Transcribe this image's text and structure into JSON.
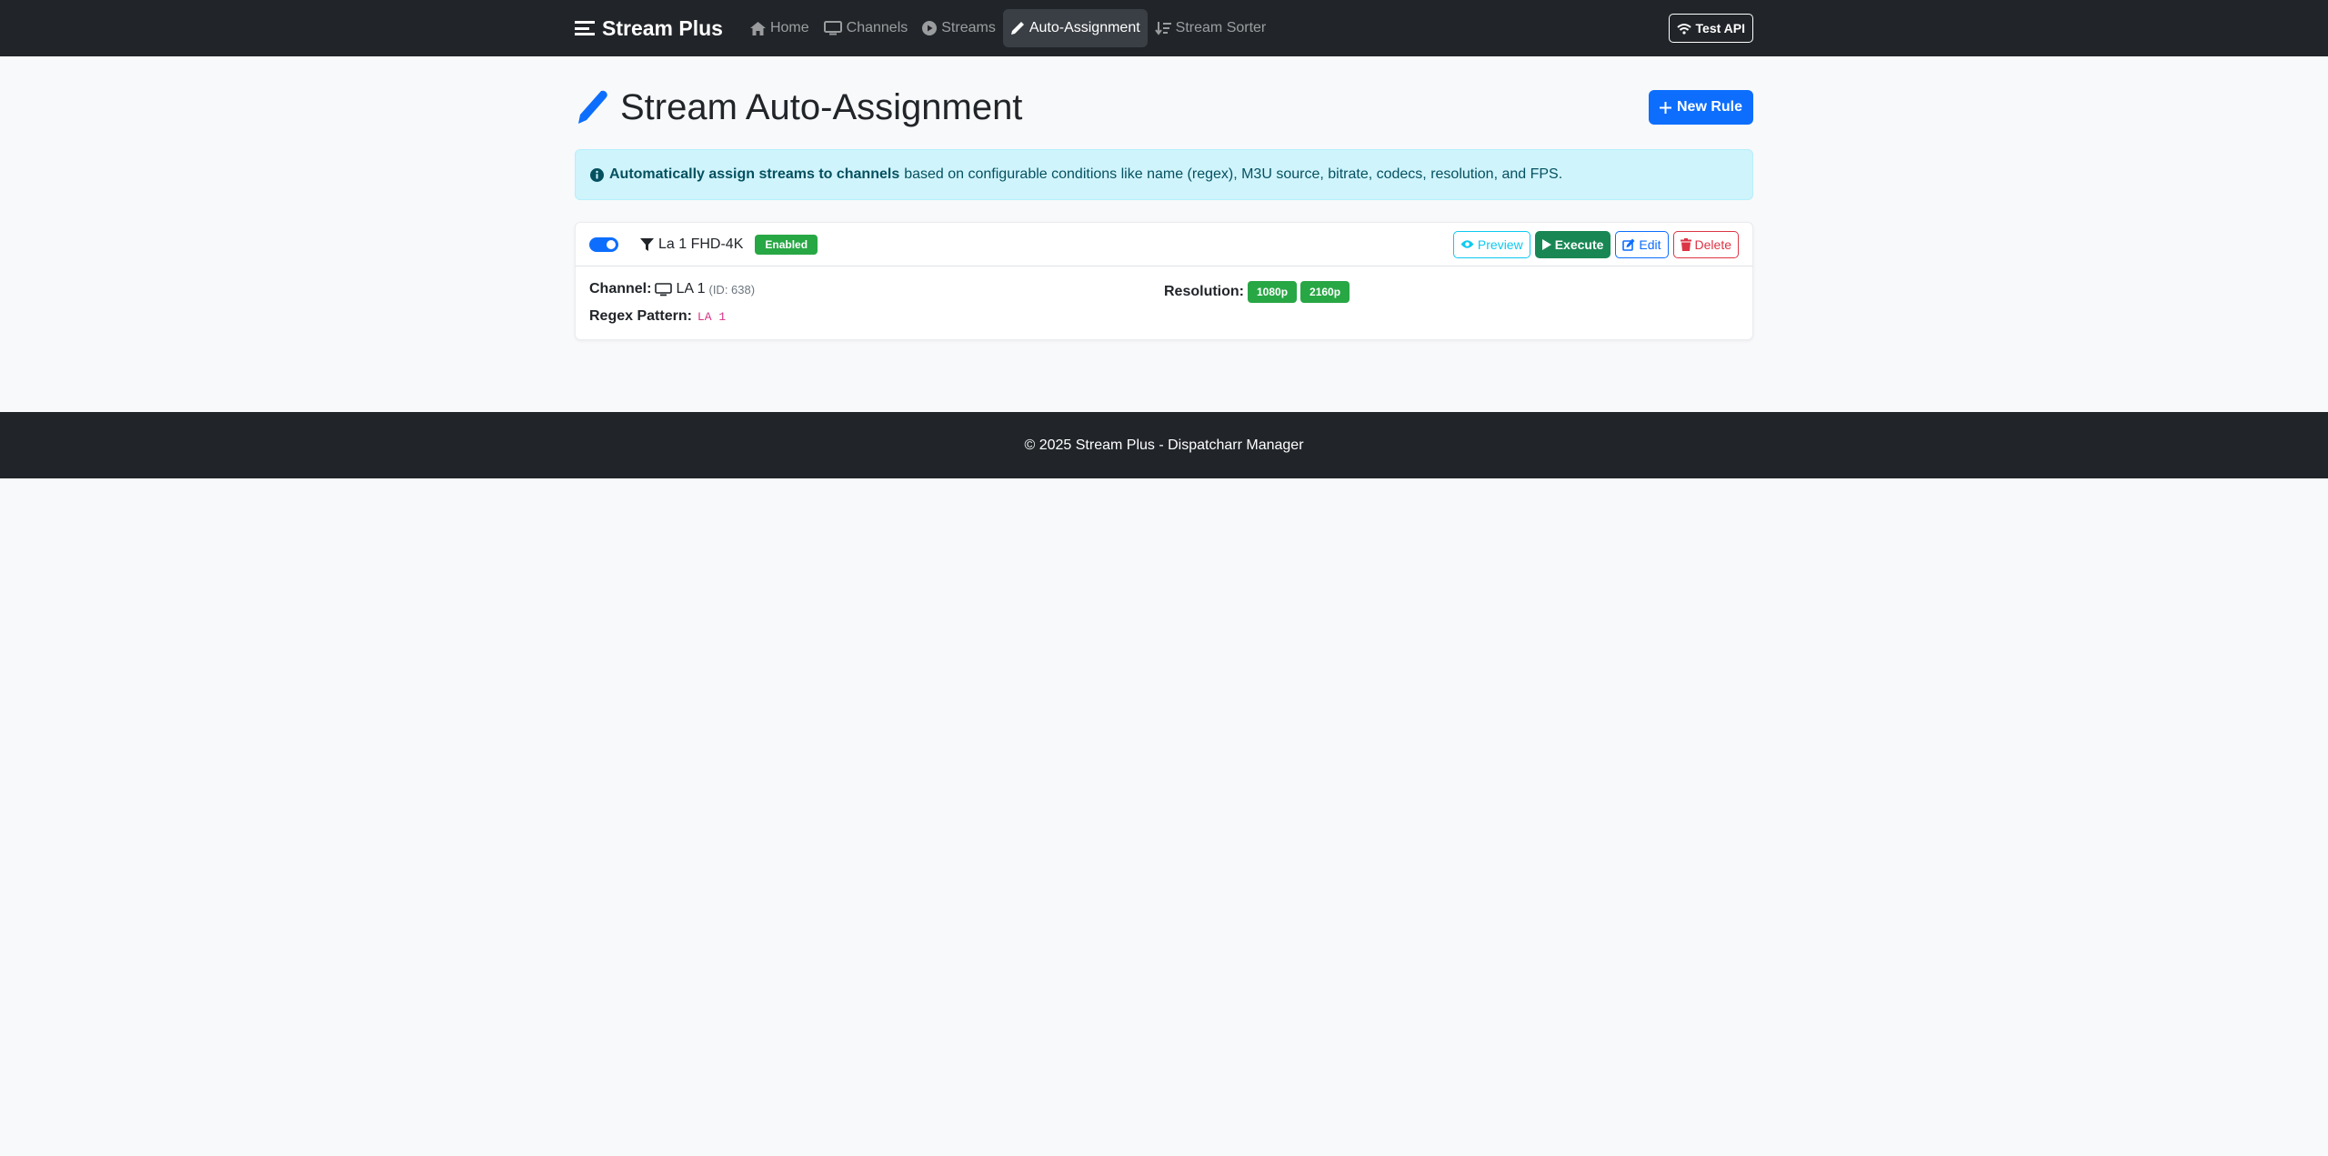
{
  "nav": {
    "brand": "Stream Plus",
    "items": [
      {
        "label": "Home",
        "icon": "home-icon",
        "active": false
      },
      {
        "label": "Channels",
        "icon": "tv-icon",
        "active": false
      },
      {
        "label": "Streams",
        "icon": "play-circle-icon",
        "active": false
      },
      {
        "label": "Auto-Assignment",
        "icon": "pencil-icon",
        "active": true
      },
      {
        "label": "Stream Sorter",
        "icon": "sort-icon",
        "active": false
      }
    ],
    "test_api": "Test API"
  },
  "page": {
    "title": "Stream Auto-Assignment",
    "new_rule": "New Rule"
  },
  "alert": {
    "strong": "Automatically assign streams to channels",
    "text": "based on configurable conditions like name (regex), M3U source, bitrate, codecs, resolution, and FPS."
  },
  "rules": [
    {
      "name": "La 1 FHD-4K",
      "status": "Enabled",
      "enabled": true,
      "actions": {
        "preview": "Preview",
        "execute": "Execute",
        "edit": "Edit",
        "delete": "Delete"
      },
      "channel_label": "Channel:",
      "channel_name": "LA 1",
      "channel_id": "(ID: 638)",
      "regex_label": "Regex Pattern:",
      "regex": "LA 1",
      "resolution_label": "Resolution:",
      "resolutions": [
        "1080p",
        "2160p"
      ]
    }
  ],
  "footer": "© 2025 Stream Plus - Dispatcharr Manager",
  "colors": {
    "navbar": "#212529",
    "primary": "#0d6efd",
    "success": "#28a745",
    "info_bg": "#cff4fc",
    "danger": "#dc3545"
  }
}
